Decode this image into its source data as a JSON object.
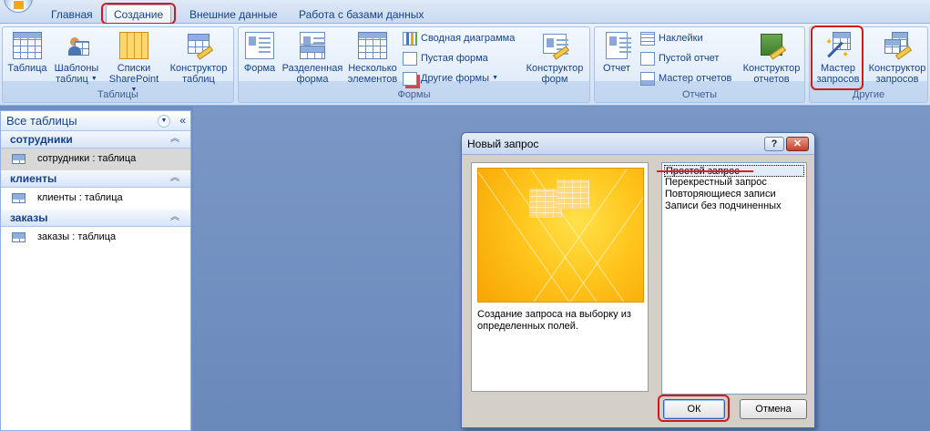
{
  "tabs": [
    {
      "label": "Главная"
    },
    {
      "label": "Создание"
    },
    {
      "label": "Внешние данные"
    },
    {
      "label": "Работа с базами данных"
    }
  ],
  "ribbon": {
    "groups": {
      "tables": "Таблицы",
      "forms": "Формы",
      "reports": "Отчеты",
      "other": "Другие"
    },
    "tables": {
      "table": "Таблица",
      "templates_1": "Шаблоны",
      "templates_2": "таблиц",
      "sharepoint_1": "Списки",
      "sharepoint_2": "SharePoint",
      "designer_1": "Конструктор",
      "designer_2": "таблиц"
    },
    "forms": {
      "form": "Форма",
      "split_1": "Разделенная",
      "split_2": "форма",
      "multi_1": "Несколько",
      "multi_2": "элементов",
      "pivot_chart": "Сводная диаграмма",
      "blank_form": "Пустая форма",
      "more_forms": "Другие формы",
      "designer_1": "Конструктор",
      "designer_2": "форм"
    },
    "reports": {
      "report": "Отчет",
      "labels": "Наклейки",
      "blank_report": "Пустой отчет",
      "wizard": "Мастер отчетов",
      "designer_1": "Конструктор",
      "designer_2": "отчетов"
    },
    "other": {
      "query_wizard_1": "Мастер",
      "query_wizard_2": "запросов",
      "query_designer_1": "Конструктор",
      "query_designer_2": "запросов"
    }
  },
  "nav": {
    "header": "Все таблицы",
    "groups": [
      {
        "name": "сотрудники",
        "item": "сотрудники : таблица"
      },
      {
        "name": "клиенты",
        "item": "клиенты : таблица"
      },
      {
        "name": "заказы",
        "item": "заказы : таблица"
      }
    ]
  },
  "dialog": {
    "title": "Новый запрос",
    "help": "?",
    "description": "Создание запроса на выборку из определенных полей.",
    "options": [
      "Простой запрос",
      "Перекрестный запрос",
      "Повторяющиеся записи",
      "Записи без подчиненных"
    ],
    "ok": "ОК",
    "cancel": "Отмена"
  },
  "colors": {
    "accent_red": "#d11a1a",
    "ribbon_text": "#15428b",
    "workspace": "#6f8fbe"
  }
}
